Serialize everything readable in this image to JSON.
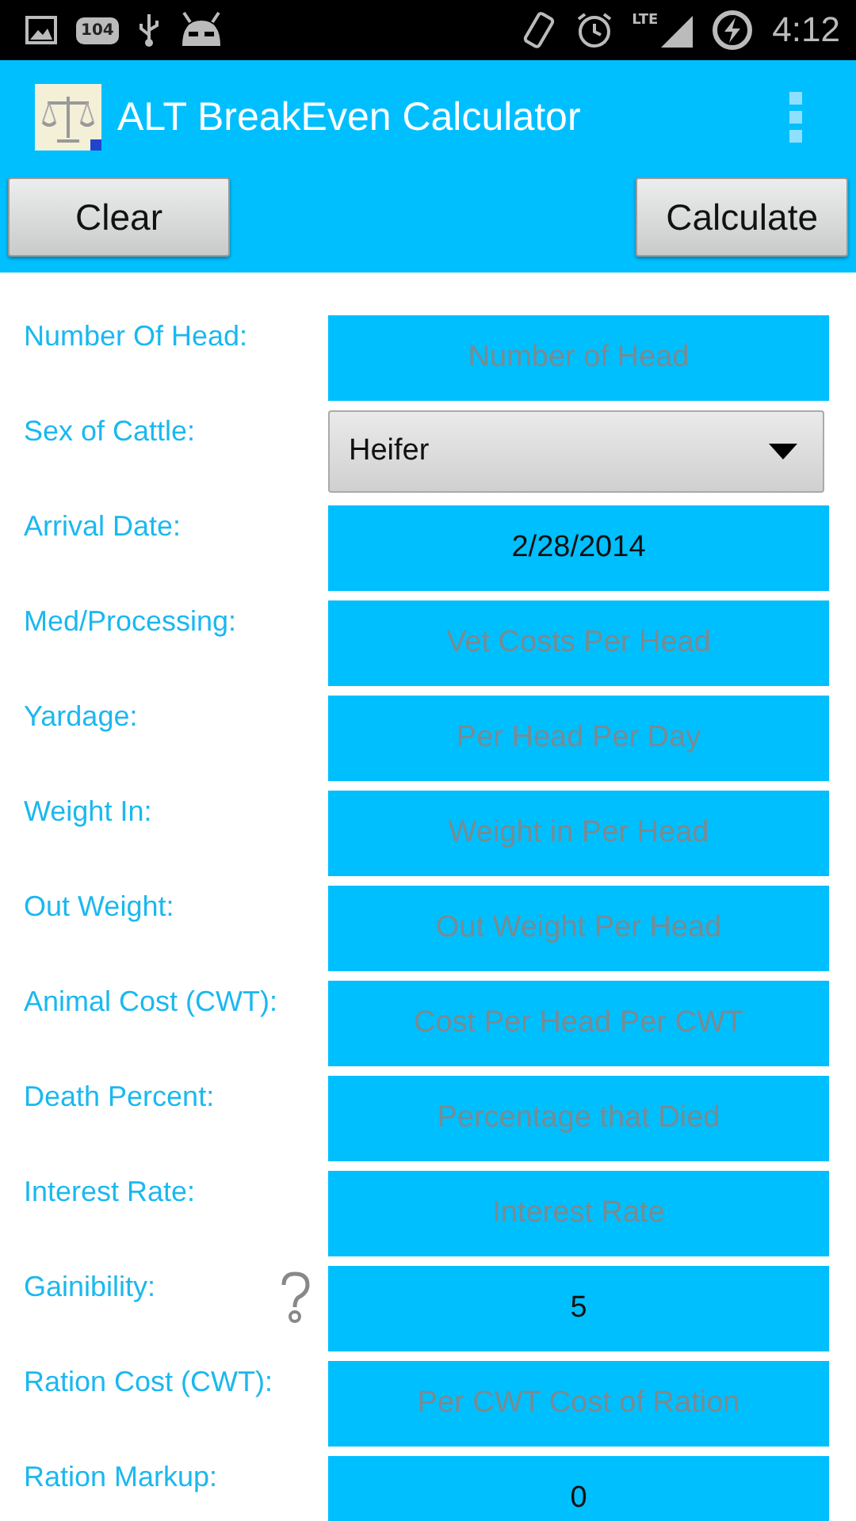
{
  "status_bar": {
    "notification_badge": "104",
    "network": "LTE",
    "time": "4:12"
  },
  "app_bar": {
    "title": "ALT BreakEven Calculator"
  },
  "buttons": [
    "Clear",
    "Calculate"
  ],
  "rows": [
    {
      "label": "Number Of Head:",
      "kind": "text",
      "placeholder": "Number of Head",
      "help": false
    },
    {
      "label": "Sex of Cattle:",
      "kind": "dropdown",
      "value": "Heifer",
      "help": false
    },
    {
      "label": "Arrival Date:",
      "kind": "text",
      "value": "2/28/2014",
      "help": false
    },
    {
      "label": "Med/Processing:",
      "kind": "text",
      "placeholder": "Vet Costs Per Head",
      "help": false
    },
    {
      "label": "Yardage:",
      "kind": "text",
      "placeholder": "Per Head Per Day",
      "help": false
    },
    {
      "label": "Weight In:",
      "kind": "text",
      "placeholder": "Weight in Per Head",
      "help": false
    },
    {
      "label": "Out Weight:",
      "kind": "text",
      "placeholder": "Out Weight Per Head",
      "help": false
    },
    {
      "label": "Animal Cost (CWT):",
      "kind": "text",
      "placeholder": "Cost Per Head Per CWT",
      "help": false
    },
    {
      "label": "Death Percent:",
      "kind": "text",
      "placeholder": "Percentage that Died",
      "help": false
    },
    {
      "label": "Interest Rate:",
      "kind": "text",
      "placeholder": "Interest Rate",
      "help": false
    },
    {
      "label": "Gainibility:",
      "kind": "text",
      "value": "5",
      "help": true
    },
    {
      "label": "Ration Cost (CWT):",
      "kind": "text",
      "placeholder": "Per CWT Cost of Ration",
      "help": false
    },
    {
      "label": "Ration Markup:",
      "kind": "text",
      "value": "0",
      "help": false
    }
  ]
}
